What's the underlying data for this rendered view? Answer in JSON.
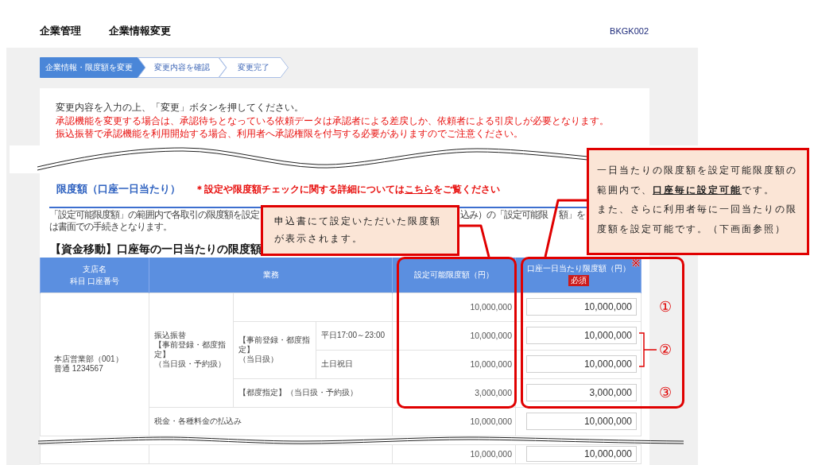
{
  "header": {
    "breadcrumb": [
      "企業管理",
      "企業情報変更"
    ],
    "screen_id": "BKGK002"
  },
  "steps": [
    {
      "label": "企業情報・限度額を変更",
      "selected": true
    },
    {
      "label": "変更内容を確認",
      "selected": false
    },
    {
      "label": "変更完了",
      "selected": false
    }
  ],
  "instructions": [
    {
      "kind": "normal",
      "text": "変更内容を入力の上、「変更」ボタンを押してください。"
    },
    {
      "kind": "warning",
      "text": "承認機能を変更する場合は、承認待ちとなっている依頼データは承認者による差戻しか、依頼者による引戻しが必要となります。"
    },
    {
      "kind": "warning",
      "text": "振込振替で承認機能を利用開始する場合、利用者へ承認権限を付与する必要がありますのでご注意ください。"
    }
  ],
  "section": {
    "break_before": true,
    "title": "限度額（口座一日当たり）",
    "note": {
      "text": "＊設定や限度額チェックに関する詳細については",
      "link": "こちら",
      "after": "をご覧ください"
    },
    "description": [
      [
        "「設定可能限度額」の範囲内で各取引の限度額を設定",
        "込み）の「設定可能限",
        "額」を"
      ],
      [
        "は書面での手続きとなります。"
      ]
    ]
  },
  "limit_table": {
    "title": "【資金移動】口座毎の一日当たりの限度額",
    "columns": [
      {
        "label": "支店名",
        "sublabel": "科目 口座番号"
      },
      {
        "label": "業務"
      },
      {
        "label": "設定可能限度額（円）"
      },
      {
        "label": "口座一日当たり限度額（円）",
        "mark": "※",
        "badge": "必須"
      }
    ],
    "accounts": [
      {
        "branch": "本店営業部（001）",
        "number": "普通 1234567",
        "services": [
          {
            "kind": "group",
            "name": [
              "振込振替",
              "【事前登録・都度指定】",
              "（当日扱・予約扱）"
            ],
            "limits": [
              {
                "kind": "total",
                "max": "10,000,000",
                "value": "10,000,000"
              },
              {
                "kind": "split",
                "name": [
                  "【事前登録・都度指定】",
                  "（当日扱）"
                ],
                "periods": [
                  {
                    "name": "平日17:00～23:00",
                    "max": "10,000,000",
                    "value": "10,000,000"
                  },
                  {
                    "name": "土日祝日",
                    "max": "10,000,000",
                    "value": "10,000,000"
                  }
                ]
              },
              {
                "kind": "single",
                "name": "【都度指定】（当日扱・予約扱）",
                "max": "3,000,000",
                "value": "3,000,000"
              }
            ]
          },
          {
            "kind": "single",
            "name": "税金・各種料金の払込み",
            "max": "10,000,000",
            "value": "10,000,000"
          }
        ]
      },
      {
        "break_before": true,
        "services": [
          {
            "kind": "single",
            "max": "10,000,000",
            "value": "10,000,000"
          }
        ]
      }
    ]
  },
  "callouts": [
    {
      "text": [
        "申込書にて設定いただいた限度額が表示されます。"
      ]
    },
    {
      "text": [
        "一日当たりの限度額を設定可能限度額の範囲内で、**口座毎に設定可能**です。",
        "また、さらに利用者毎に一回当たりの限度額を設定可能です。（下画面参照）"
      ]
    }
  ],
  "markers": [
    "①",
    "②",
    "③"
  ]
}
